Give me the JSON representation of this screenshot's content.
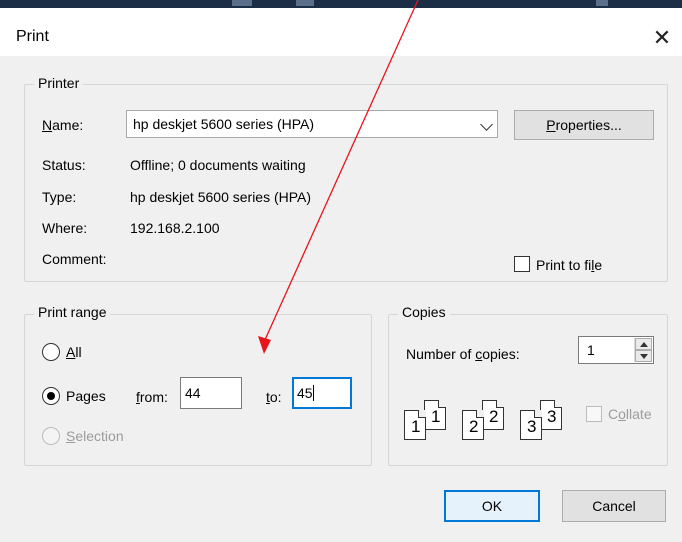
{
  "window": {
    "title": "Print",
    "close_glyph": "✕"
  },
  "printer": {
    "group_label": "Printer",
    "name_label": "Name:",
    "name_value": "hp deskjet 5600 series (HPA)",
    "properties_label": "Properties...",
    "status_label": "Status:",
    "status_value": "Offline; 0 documents waiting",
    "type_label": "Type:",
    "type_value": "hp deskjet 5600 series (HPA)",
    "where_label": "Where:",
    "where_value": "192.168.2.100",
    "comment_label": "Comment:",
    "print_to_file_label": "Print to file",
    "print_to_file_checked": false
  },
  "range": {
    "group_label": "Print range",
    "all_label": "All",
    "pages_label": "Pages",
    "selection_label": "Selection",
    "selected": "Pages",
    "from_label": "from:",
    "from_value": "44",
    "to_label": "to:",
    "to_value": "45"
  },
  "copies": {
    "group_label": "Copies",
    "number_label": "Number of copies:",
    "number_value": "1",
    "collate_label": "Collate",
    "collate_enabled": false,
    "collate_icon_pages": [
      "1",
      "1",
      "2",
      "2",
      "3",
      "3"
    ]
  },
  "buttons": {
    "ok": "OK",
    "cancel": "Cancel"
  },
  "annotation": {
    "arrow_color": "#e8141b"
  },
  "colors": {
    "focus": "#0078d7"
  }
}
